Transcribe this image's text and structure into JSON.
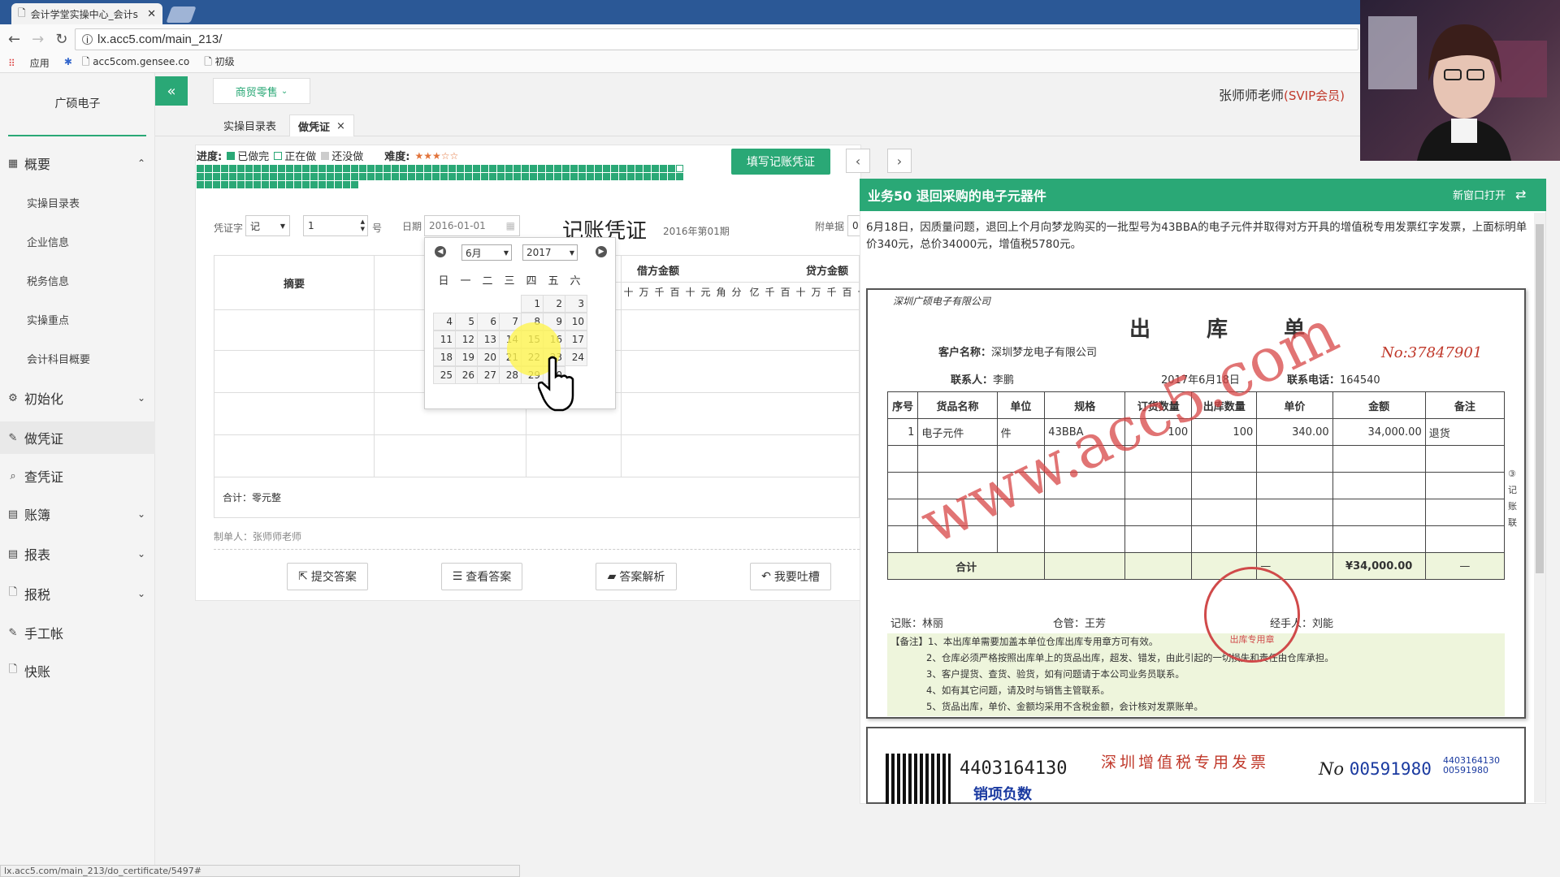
{
  "browser": {
    "tab_title": "会计学堂实操中心_会计s",
    "url": "lx.acc5.com/main_213/",
    "bookmarks": [
      "应用",
      "acc5com.gensee.co",
      "初级"
    ]
  },
  "sidebar": {
    "company": "广硕电子",
    "items": [
      {
        "label": "概要",
        "icon": "grid-icon",
        "chevron": "up"
      },
      {
        "label": "初始化",
        "icon": "gear-icon",
        "chevron": "down"
      },
      {
        "label": "做凭证",
        "icon": "pencil-icon",
        "chevron": ""
      },
      {
        "label": "查凭证",
        "icon": "search-icon",
        "chevron": ""
      },
      {
        "label": "账簿",
        "icon": "book-icon",
        "chevron": "down"
      },
      {
        "label": "报表",
        "icon": "report-icon",
        "chevron": "down"
      },
      {
        "label": "报税",
        "icon": "file-icon",
        "chevron": "down"
      },
      {
        "label": "手工帐",
        "icon": "pencil-icon",
        "chevron": ""
      },
      {
        "label": "快账",
        "icon": "file-icon",
        "chevron": ""
      }
    ],
    "sub_items": [
      "实操目录表",
      "企业信息",
      "税务信息",
      "实操重点",
      "会计科目概要"
    ]
  },
  "header": {
    "collapse_icon": "«",
    "menu": "商贸零售",
    "user": "张师师老师",
    "vip": "(SVIP会员)"
  },
  "tabs": [
    {
      "label": "实操目录表"
    },
    {
      "label": "做凭证",
      "close": "×"
    }
  ],
  "progress": {
    "label": "进度:",
    "done": "已做完",
    "doing": "正在做",
    "todo": "还没做",
    "difficulty_label": "难度:",
    "difficulty_stars": "★★★☆☆",
    "fill_button": "填写记账凭证"
  },
  "voucher": {
    "word_label": "凭证字",
    "word_value": "记",
    "number_value": "1",
    "number_suffix": "号",
    "date_label": "日期",
    "date_value": "2016-01-01",
    "title": "记账凭证",
    "period": "2016年第01期",
    "attach_label": "附单据",
    "attach_value": "0",
    "col_summary": "摘要",
    "col_debit": "借方金额",
    "col_credit": "贷方金额",
    "units": [
      "亿",
      "千",
      "百",
      "十",
      "万",
      "千",
      "百",
      "十",
      "元",
      "角",
      "分"
    ],
    "units_visible_debit": [
      "十",
      "万",
      "千",
      "百",
      "十",
      "元",
      "角",
      "分"
    ],
    "units_visible_credit": [
      "亿",
      "千",
      "百",
      "十",
      "万",
      "千",
      "百",
      "十"
    ],
    "total": "合计：零元整",
    "maker": "制单人：张师师老师",
    "buttons": [
      "提交答案",
      "查看答案",
      "答案解析",
      "我要吐槽"
    ]
  },
  "calendar": {
    "month": "6月",
    "year": "2017",
    "weekdays": [
      "日",
      "一",
      "二",
      "三",
      "四",
      "五",
      "六"
    ],
    "weeks": [
      [
        "",
        "",
        "",
        "",
        "1",
        "2",
        "3"
      ],
      [
        "4",
        "5",
        "6",
        "7",
        "8",
        "9",
        "10"
      ],
      [
        "11",
        "12",
        "13",
        "14",
        "15",
        "16",
        "17"
      ],
      [
        "18",
        "19",
        "20",
        "21",
        "22",
        "23",
        "24"
      ],
      [
        "25",
        "26",
        "27",
        "28",
        "29",
        "30",
        ""
      ]
    ]
  },
  "task": {
    "title": "业务50 退回采购的电子元器件",
    "open_new": "新窗口打开",
    "description": "6月18日，因质量问题，退回上个月向梦龙购买的一批型号为43BBA的电子元件并取得对方开具的增值税专用发票红字发票，上面标明单价340元，总价34000元，增值税5780元。"
  },
  "receipt": {
    "company": "深圳广硕电子有限公司",
    "title": "出 库 单",
    "customer_label": "客户名称：",
    "customer": "深圳梦龙电子有限公司",
    "no": "No:37847901",
    "contact_label": "联系人：",
    "contact": "李鹏",
    "date": "2017年6月18日",
    "phone_label": "联系电话：",
    "phone": "164540",
    "headers": [
      "序号",
      "货品名称",
      "单位",
      "规格",
      "订货数量",
      "出库数量",
      "单价",
      "金额",
      "备注"
    ],
    "row": [
      "1",
      "电子元件",
      "件",
      "43BBA",
      "100",
      "100",
      "340.00",
      "34,000.00",
      "退货"
    ],
    "total_label": "合计",
    "total_dash": "—",
    "total_amount": "¥34,000.00",
    "bookkeeper": "记账：林丽",
    "warehouse": "仓管：王芳",
    "handler": "经手人：刘能",
    "notes": [
      "【备注】1、本出库单需要加盖本单位仓库出库专用章方可有效。",
      "2、仓库必须严格按照出库单上的货品出库，超发、错发，由此引起的一切损失和责任由仓库承担。",
      "3、客户提货、查货、验货，如有问题请于本公司业务员联系。",
      "4、如有其它问题，请及时与销售主管联系。",
      "5、货品出库，单价、金额均采用不含税金额，会计核对发票账单。"
    ],
    "side_note": "③记账联",
    "stamp": "出库专用章",
    "watermark": "www.acc5.com"
  },
  "invoice": {
    "code": "4403164130",
    "tag": "销项负数",
    "title": "深圳增值税专用发票",
    "no_prefix": "No",
    "no": "00591980",
    "small_code": "4403164130",
    "small_no": "00591980"
  },
  "status_url": "lx.acc5.com/main_213/do_certificate/5497#",
  "colors": {
    "accent": "#2aa876",
    "red": "#c0392b",
    "blue": "#1a3aa0"
  }
}
